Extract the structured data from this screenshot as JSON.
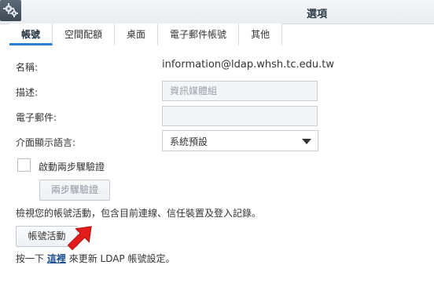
{
  "window": {
    "title": "選項"
  },
  "tabs": [
    {
      "label": "帳號",
      "active": true
    },
    {
      "label": "空間配額",
      "active": false
    },
    {
      "label": "桌面",
      "active": false
    },
    {
      "label": "電子郵件帳號",
      "active": false
    },
    {
      "label": "其他",
      "active": false
    }
  ],
  "form": {
    "name_label": "名稱:",
    "name_value": "information@ldap.whsh.tc.edu.tw",
    "description_label": "描述:",
    "description_value": "資訊媒體組",
    "email_label": "電子郵件:",
    "email_value": "",
    "language_label": "介面顯示語言:",
    "language_value": "系統預設",
    "two_step_label": "啟動兩步驟驗證",
    "two_step_checked": false,
    "two_step_button": "兩步驟驗證"
  },
  "activity": {
    "note": "檢視您的帳號活動，包含目前連線、信任裝置及登入記錄。",
    "button": "帳號活動"
  },
  "footer": {
    "prefix": "按一下",
    "link": "這裡",
    "suffix": "來更新 LDAP 帳號設定。"
  },
  "colors": {
    "accent": "#2a7fd4",
    "link": "#1d4f91",
    "annotation_arrow": "#e21b1b"
  },
  "icons": {
    "app": "gears-icon",
    "dropdown": "chevron-down-icon",
    "annotation": "red-arrow-icon"
  }
}
